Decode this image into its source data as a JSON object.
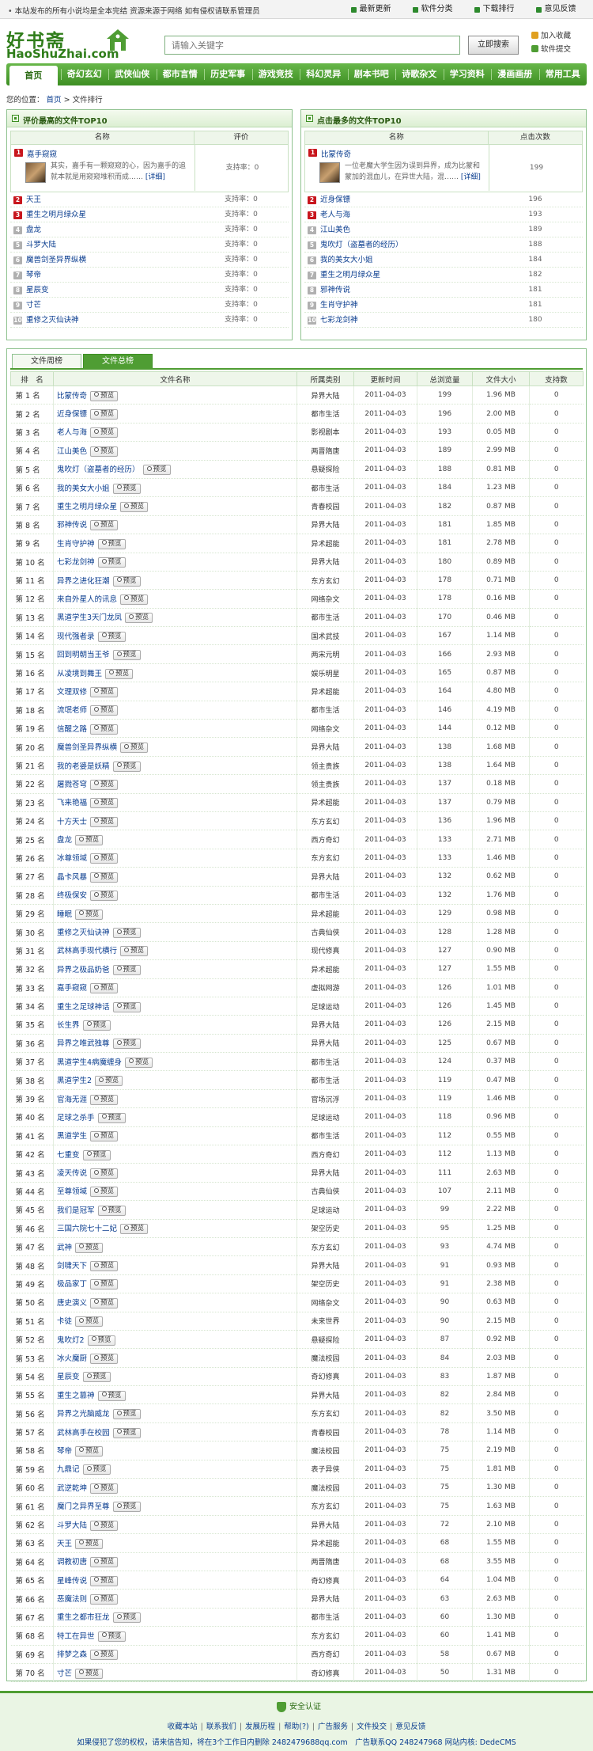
{
  "topbar": {
    "notice": "本站发布的所有小说均是全本完结 资源来源于网络 如有侵权请联系管理员",
    "links": [
      "最新更新",
      "软件分类",
      "下载排行",
      "意见反馈"
    ]
  },
  "header": {
    "logo_cn": "好书斋",
    "logo_en": "HaoShuZhai.com",
    "search_placeholder": "请输入关键字",
    "search_button": "立即搜索",
    "fav": "加入收藏",
    "submit": "软件提交"
  },
  "nav": [
    "首页",
    "奇幻玄幻",
    "武侠仙侠",
    "都市言情",
    "历史军事",
    "游戏竞技",
    "科幻灵异",
    "剧本书吧",
    "诗歌杂文",
    "学习资料",
    "漫画画册",
    "常用工具"
  ],
  "breadcrumb": {
    "label": "您的位置：",
    "home": "首页",
    "sep": ">",
    "current": "文件排行"
  },
  "colors": {
    "brand_green": "#4f9d33",
    "rank_red": "#c8161d",
    "link_blue": "#0a3d8f"
  },
  "panel_left": {
    "title": "评价最高的文件TOP10",
    "col_name": "名称",
    "col_val": "评价",
    "featured": {
      "rank": "1",
      "title": "嘉手窥窥",
      "desc": "其实，嘉手有一颗窥窥的心，因为嘉手的追就本就是用窥窥堆积而成……",
      "more": "[详细]",
      "value": "支持率：0"
    },
    "rows": [
      {
        "rank": "2",
        "name": "天王",
        "value": "支持率：0"
      },
      {
        "rank": "3",
        "name": "重生之明月绿众星",
        "value": "支持率：0"
      },
      {
        "rank": "4",
        "name": "盘龙",
        "value": "支持率：0"
      },
      {
        "rank": "5",
        "name": "斗罗大陆",
        "value": "支持率：0"
      },
      {
        "rank": "6",
        "name": "魔兽剑圣异界纵横",
        "value": "支持率：0"
      },
      {
        "rank": "7",
        "name": "琴帝",
        "value": "支持率：0"
      },
      {
        "rank": "8",
        "name": "星辰变",
        "value": "支持率：0"
      },
      {
        "rank": "9",
        "name": "寸芒",
        "value": "支持率：0"
      },
      {
        "rank": "10",
        "name": "重修之灭仙诀神",
        "value": "支持率：0"
      }
    ]
  },
  "panel_right": {
    "title": "点击最多的文件TOP10",
    "col_name": "名称",
    "col_val": "点击次数",
    "featured": {
      "rank": "1",
      "title": "比蒙传奇",
      "desc": "一位老魔大学生因为误到异界，成为比蒙和蒙加的混血儿，在异世大陆，混……",
      "more": "[详细]",
      "value": "199"
    },
    "rows": [
      {
        "rank": "2",
        "name": "近身保镖",
        "value": "196"
      },
      {
        "rank": "3",
        "name": "老人与海",
        "value": "193"
      },
      {
        "rank": "4",
        "name": "江山美色",
        "value": "189"
      },
      {
        "rank": "5",
        "name": "鬼吹灯（盗墓者的经历）",
        "value": "188"
      },
      {
        "rank": "6",
        "name": "我的美女大小姐",
        "value": "184"
      },
      {
        "rank": "7",
        "name": "重生之明月绿众星",
        "value": "182"
      },
      {
        "rank": "8",
        "name": "邪神传说",
        "value": "181"
      },
      {
        "rank": "9",
        "name": "生肖守护神",
        "value": "181"
      },
      {
        "rank": "10",
        "name": "七彩龙剑神",
        "value": "180"
      }
    ]
  },
  "rank_list": {
    "tabs": [
      "文件周榜",
      "文件总榜"
    ],
    "headers": [
      "排　名",
      "文件名称",
      "所属类别",
      "更新时间",
      "总浏览量",
      "文件大小",
      "支持数"
    ],
    "preview_label": "预览",
    "rank_prefix": "第",
    "rank_suffix": "名",
    "rows": [
      [
        "1",
        "比蒙传奇",
        "异界大陆",
        "2011-04-03",
        "199",
        "1.96 MB",
        "0"
      ],
      [
        "2",
        "近身保镖",
        "都市生活",
        "2011-04-03",
        "196",
        "2.00 MB",
        "0"
      ],
      [
        "3",
        "老人与海",
        "影视剧本",
        "2011-04-03",
        "193",
        "0.05 MB",
        "0"
      ],
      [
        "4",
        "江山美色",
        "两晋隋唐",
        "2011-04-03",
        "189",
        "2.99 MB",
        "0"
      ],
      [
        "5",
        "鬼吹灯（盗墓者的经历）",
        "悬疑探险",
        "2011-04-03",
        "188",
        "0.81 MB",
        "0"
      ],
      [
        "6",
        "我的美女大小姐",
        "都市生活",
        "2011-04-03",
        "184",
        "1.23 MB",
        "0"
      ],
      [
        "7",
        "重生之明月绿众星",
        "青春校园",
        "2011-04-03",
        "182",
        "0.87 MB",
        "0"
      ],
      [
        "8",
        "邪神传说",
        "异界大陆",
        "2011-04-03",
        "181",
        "1.85 MB",
        "0"
      ],
      [
        "9",
        "生肖守护神",
        "异术超能",
        "2011-04-03",
        "181",
        "2.78 MB",
        "0"
      ],
      [
        "10",
        "七彩龙剑神",
        "异界大陆",
        "2011-04-03",
        "180",
        "0.89 MB",
        "0"
      ],
      [
        "11",
        "异界之进化狂潮",
        "东方玄幻",
        "2011-04-03",
        "178",
        "0.71 MB",
        "0"
      ],
      [
        "12",
        "来自外星人的讯息",
        "网络杂文",
        "2011-04-03",
        "178",
        "0.16 MB",
        "0"
      ],
      [
        "13",
        "黑道学生3天门龙凤",
        "都市生活",
        "2011-04-03",
        "170",
        "0.46 MB",
        "0"
      ],
      [
        "14",
        "现代强者录",
        "国术武技",
        "2011-04-03",
        "167",
        "1.14 MB",
        "0"
      ],
      [
        "15",
        "回到明朝当王爷",
        "两宋元明",
        "2011-04-03",
        "166",
        "2.93 MB",
        "0"
      ],
      [
        "16",
        "从凌境到舞王",
        "娱乐明星",
        "2011-04-03",
        "165",
        "0.87 MB",
        "0"
      ],
      [
        "17",
        "文理双修",
        "异术超能",
        "2011-04-03",
        "164",
        "4.80 MB",
        "0"
      ],
      [
        "18",
        "流氓老师",
        "都市生活",
        "2011-04-03",
        "146",
        "4.19 MB",
        "0"
      ],
      [
        "19",
        "信醒之路",
        "网络杂文",
        "2011-04-03",
        "144",
        "0.12 MB",
        "0"
      ],
      [
        "20",
        "魔兽剑圣异界纵横",
        "异界大陆",
        "2011-04-03",
        "138",
        "1.68 MB",
        "0"
      ],
      [
        "21",
        "我的老婆是妖精",
        "领主贵族",
        "2011-04-03",
        "138",
        "1.64 MB",
        "0"
      ],
      [
        "22",
        "屠戮苍穹",
        "领主贵族",
        "2011-04-03",
        "137",
        "0.18 MB",
        "0"
      ],
      [
        "23",
        "飞来艳福",
        "异术超能",
        "2011-04-03",
        "137",
        "0.79 MB",
        "0"
      ],
      [
        "24",
        "十方天士",
        "东方玄幻",
        "2011-04-03",
        "136",
        "1.96 MB",
        "0"
      ],
      [
        "25",
        "盘龙",
        "西方奇幻",
        "2011-04-03",
        "133",
        "2.71 MB",
        "0"
      ],
      [
        "26",
        "冰尊领域",
        "东方玄幻",
        "2011-04-03",
        "133",
        "1.46 MB",
        "0"
      ],
      [
        "27",
        "晶卡风暴",
        "异界大陆",
        "2011-04-03",
        "132",
        "0.62 MB",
        "0"
      ],
      [
        "28",
        "终极保安",
        "都市生活",
        "2011-04-03",
        "132",
        "1.76 MB",
        "0"
      ],
      [
        "29",
        "睡眠",
        "异术超能",
        "2011-04-03",
        "129",
        "0.98 MB",
        "0"
      ],
      [
        "30",
        "重修之灭仙诀神",
        "古典仙侠",
        "2011-04-03",
        "128",
        "1.28 MB",
        "0"
      ],
      [
        "31",
        "武林高手现代横行",
        "现代修真",
        "2011-04-03",
        "127",
        "0.90 MB",
        "0"
      ],
      [
        "32",
        "异界之极品奶爸",
        "异术超能",
        "2011-04-03",
        "127",
        "1.55 MB",
        "0"
      ],
      [
        "33",
        "嘉手窥窥",
        "虚拟网游",
        "2011-04-03",
        "126",
        "1.01 MB",
        "0"
      ],
      [
        "34",
        "重生之足球神话",
        "足球运动",
        "2011-04-03",
        "126",
        "1.45 MB",
        "0"
      ],
      [
        "35",
        "长生界",
        "异界大陆",
        "2011-04-03",
        "126",
        "2.15 MB",
        "0"
      ],
      [
        "36",
        "异界之唯武独尊",
        "异界大陆",
        "2011-04-03",
        "125",
        "0.67 MB",
        "0"
      ],
      [
        "37",
        "黑道学生4病魔缠身",
        "都市生活",
        "2011-04-03",
        "124",
        "0.37 MB",
        "0"
      ],
      [
        "38",
        "黑道学生2",
        "都市生活",
        "2011-04-03",
        "119",
        "0.47 MB",
        "0"
      ],
      [
        "39",
        "官海无涯",
        "官场沉浮",
        "2011-04-03",
        "119",
        "1.46 MB",
        "0"
      ],
      [
        "40",
        "足球之杀手",
        "足球运动",
        "2011-04-03",
        "118",
        "0.96 MB",
        "0"
      ],
      [
        "41",
        "黑道学生",
        "都市生活",
        "2011-04-03",
        "112",
        "0.55 MB",
        "0"
      ],
      [
        "42",
        "七重变",
        "西方奇幻",
        "2011-04-03",
        "112",
        "1.13 MB",
        "0"
      ],
      [
        "43",
        "凌天传说",
        "异界大陆",
        "2011-04-03",
        "111",
        "2.63 MB",
        "0"
      ],
      [
        "44",
        "至尊领域",
        "古典仙侠",
        "2011-04-03",
        "107",
        "2.11 MB",
        "0"
      ],
      [
        "45",
        "我们是冠军",
        "足球运动",
        "2011-04-03",
        "99",
        "2.22 MB",
        "0"
      ],
      [
        "46",
        "三国六院七十二妃",
        "架空历史",
        "2011-04-03",
        "95",
        "1.25 MB",
        "0"
      ],
      [
        "47",
        "武神",
        "东方玄幻",
        "2011-04-03",
        "93",
        "4.74 MB",
        "0"
      ],
      [
        "48",
        "剑啸天下",
        "异界大陆",
        "2011-04-03",
        "91",
        "0.93 MB",
        "0"
      ],
      [
        "49",
        "极品家丁",
        "架空历史",
        "2011-04-03",
        "91",
        "2.38 MB",
        "0"
      ],
      [
        "50",
        "唐史演义",
        "网络杂文",
        "2011-04-03",
        "90",
        "0.63 MB",
        "0"
      ],
      [
        "51",
        "卡徒",
        "未来世界",
        "2011-04-03",
        "90",
        "2.15 MB",
        "0"
      ],
      [
        "52",
        "鬼吹灯2",
        "悬疑探险",
        "2011-04-03",
        "87",
        "0.92 MB",
        "0"
      ],
      [
        "53",
        "冰火魔厨",
        "魔法校园",
        "2011-04-03",
        "84",
        "2.03 MB",
        "0"
      ],
      [
        "54",
        "星辰变",
        "奇幻修真",
        "2011-04-03",
        "83",
        "1.87 MB",
        "0"
      ],
      [
        "55",
        "重生之篡神",
        "异界大陆",
        "2011-04-03",
        "82",
        "2.84 MB",
        "0"
      ],
      [
        "56",
        "异界之光脑威龙",
        "东方玄幻",
        "2011-04-03",
        "82",
        "3.50 MB",
        "0"
      ],
      [
        "57",
        "武林高手在校园",
        "青春校园",
        "2011-04-03",
        "78",
        "1.14 MB",
        "0"
      ],
      [
        "58",
        "琴帝",
        "魔法校园",
        "2011-04-03",
        "75",
        "2.19 MB",
        "0"
      ],
      [
        "59",
        "九鼎记",
        "表子异侠",
        "2011-04-03",
        "75",
        "1.81 MB",
        "0"
      ],
      [
        "60",
        "武逆乾坤",
        "魔法校园",
        "2011-04-03",
        "75",
        "1.30 MB",
        "0"
      ],
      [
        "61",
        "魔门之异界至尊",
        "东方玄幻",
        "2011-04-03",
        "75",
        "1.63 MB",
        "0"
      ],
      [
        "62",
        "斗罗大陆",
        "异界大陆",
        "2011-04-03",
        "72",
        "2.10 MB",
        "0"
      ],
      [
        "63",
        "天王",
        "异术超能",
        "2011-04-03",
        "68",
        "1.55 MB",
        "0"
      ],
      [
        "64",
        "调教初唐",
        "两晋隋唐",
        "2011-04-03",
        "68",
        "3.55 MB",
        "0"
      ],
      [
        "65",
        "星峰传说",
        "奇幻修真",
        "2011-04-03",
        "64",
        "1.04 MB",
        "0"
      ],
      [
        "66",
        "恶魔法则",
        "异界大陆",
        "2011-04-03",
        "63",
        "2.63 MB",
        "0"
      ],
      [
        "67",
        "重生之都市狂龙",
        "都市生活",
        "2011-04-03",
        "60",
        "1.30 MB",
        "0"
      ],
      [
        "68",
        "特工在异世",
        "东方玄幻",
        "2011-04-03",
        "60",
        "1.41 MB",
        "0"
      ],
      [
        "69",
        "排梦之森",
        "西方奇幻",
        "2011-04-03",
        "58",
        "0.67 MB",
        "0"
      ],
      [
        "70",
        "寸芒",
        "奇幻修真",
        "2011-04-03",
        "50",
        "1.31 MB",
        "0"
      ]
    ]
  },
  "footer": {
    "safe": "安全认证",
    "links": [
      "收藏本站",
      "联系我们",
      "发展历程",
      "帮助(?)",
      "广告服务",
      "文件投交",
      "意见反馈"
    ],
    "copy": "如果侵犯了您的权权，请来信告知，将在3个工作日内删除 2482479688qq.com　广告联系QQ 248247968 网站内核: DedeCMS"
  }
}
